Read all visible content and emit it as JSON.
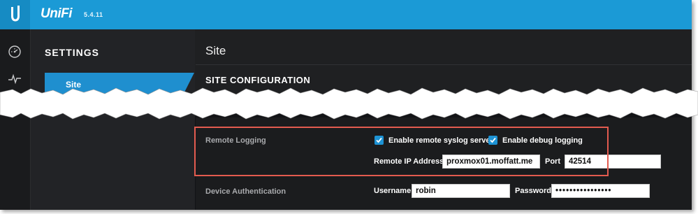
{
  "app": {
    "brand": "UniFi",
    "version": "5.4.11"
  },
  "sidebar": {
    "title": "SETTINGS",
    "active_item": "Site"
  },
  "main": {
    "title": "Site",
    "section_title": "SITE CONFIGURATION",
    "remote_logging": {
      "label": "Remote Logging",
      "enable_syslog_label": "Enable remote syslog server",
      "enable_syslog_checked": true,
      "enable_debug_label": "Enable debug logging",
      "enable_debug_checked": true,
      "ip_label": "Remote IP Address",
      "ip_value": "proxmox01.moffatt.me",
      "port_label": "Port",
      "port_value": "42514"
    },
    "device_auth": {
      "label": "Device Authentication",
      "username_label": "Username",
      "username_value": "robin",
      "password_label": "Password",
      "password_value": "••••••••••••••••"
    }
  },
  "colors": {
    "topbar": "#1b9ad6",
    "accent": "#1f8fcf",
    "highlight": "#e35b4f"
  },
  "icons": [
    "ubiquiti-logo-icon",
    "dashboard-gauge-icon",
    "statistics-pulse-icon",
    "checkbox-checked-icon"
  ]
}
